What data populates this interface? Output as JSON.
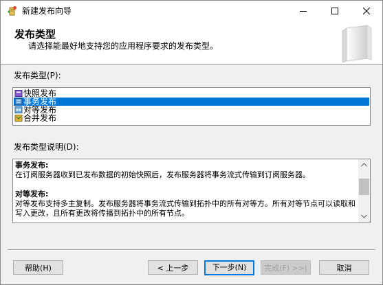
{
  "window": {
    "title": "新建发布向导"
  },
  "header": {
    "title": "发布类型",
    "subtitle": "请选择能最好地支持您的应用程序要求的发布类型。"
  },
  "publication_types": {
    "label": "发布类型(P):",
    "items": [
      {
        "label": "快照发布",
        "icon": "snapshot-publication-icon",
        "selected": false
      },
      {
        "label": "事务发布",
        "icon": "transactional-publication-icon",
        "selected": true
      },
      {
        "label": "对等发布",
        "icon": "peer-to-peer-publication-icon",
        "selected": false
      },
      {
        "label": "合并发布",
        "icon": "merge-publication-icon",
        "selected": false
      }
    ]
  },
  "description": {
    "label": "发布类型说明(D):",
    "sections": [
      {
        "heading": "事务发布:",
        "body": "在订阅服务器收到已发布数据的初始快照后，发布服务器将事务流式传输到订阅服务器。"
      },
      {
        "heading": "对等发布:",
        "body": "对等发布支持多主复制。发布服务器将事务流式传输到拓扑中的所有对等方。所有对等节点可以读取和写入更改，且所有更改将传播到拓扑中的所有节点。"
      }
    ]
  },
  "buttons": {
    "help": "帮助(H)",
    "back": "< 上一步",
    "next": "下一步(N)",
    "finish": "完成(F) >>|",
    "cancel": "取消"
  },
  "colors": {
    "selection": "#0078d7",
    "dialog_bg": "#f0f0f0",
    "header_bg": "#ffffff"
  }
}
